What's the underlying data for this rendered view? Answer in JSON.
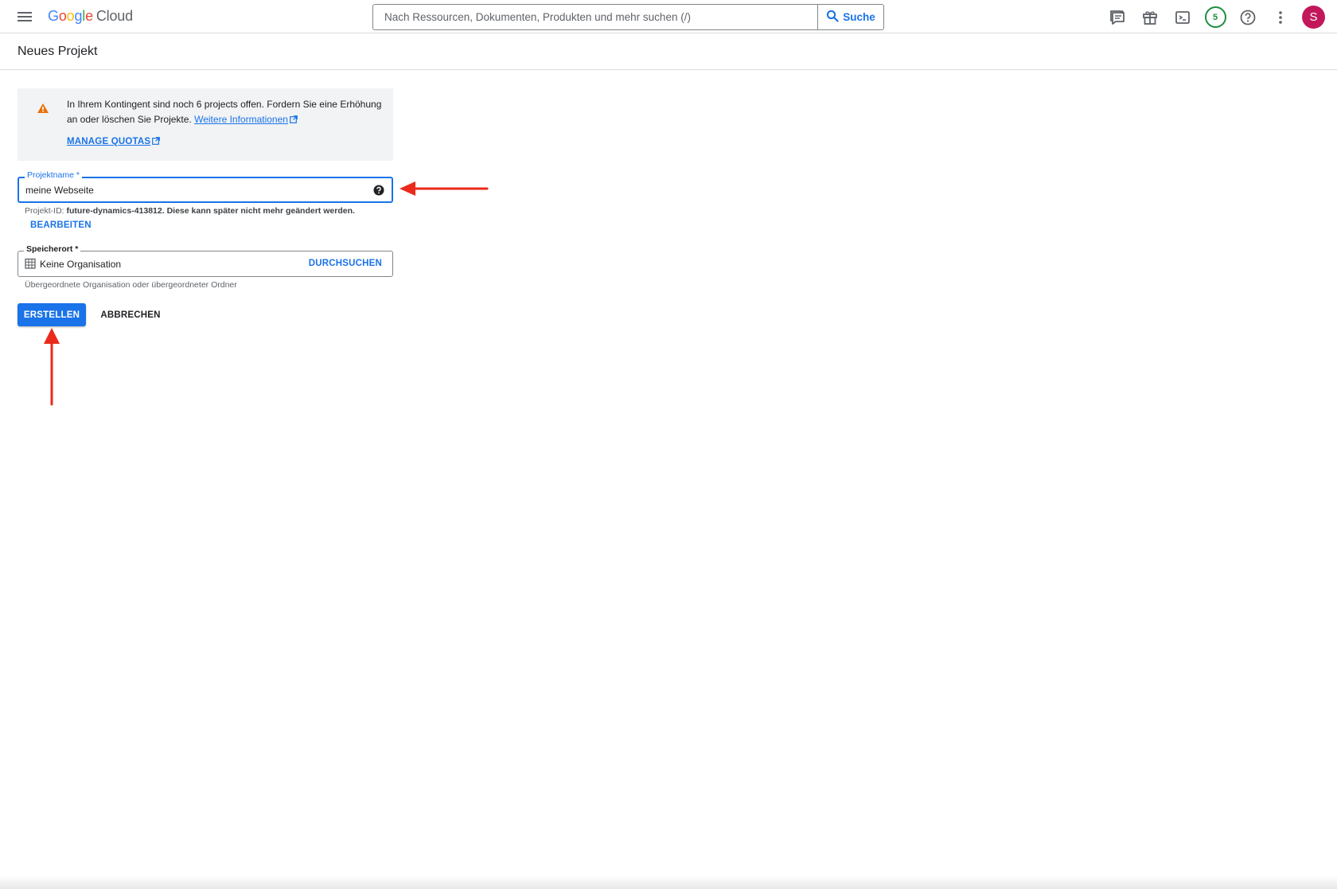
{
  "topbar": {
    "logo": {
      "google": [
        "G",
        "o",
        "o",
        "g",
        "l",
        "e"
      ],
      "cloud": "Cloud"
    },
    "search_placeholder": "Nach Ressourcen, Dokumenten, Produkten und mehr suchen (/)",
    "search_button": "Suche",
    "notification_count": "5",
    "avatar_letter": "S"
  },
  "page": {
    "title": "Neues Projekt"
  },
  "alert": {
    "text": "In Ihrem Kontingent sind noch 6 projects offen. Fordern Sie eine Erhöhung an oder löschen Sie Projekte.",
    "link": "Weitere Informationen",
    "manage_quotas": "MANAGE QUOTAS"
  },
  "project_name": {
    "label": "Projektname *",
    "value": "meine Webseite",
    "id_prefix": "Projekt-ID:",
    "id_value": "future-dynamics-413812.",
    "id_note": "Diese kann später nicht mehr geändert werden.",
    "edit": "BEARBEITEN"
  },
  "location": {
    "label": "Speicherort *",
    "value": "Keine Organisation",
    "browse": "DURCHSUCHEN",
    "hint": "Übergeordnete Organisation oder übergeordneter Ordner"
  },
  "actions": {
    "create": "ERSTELLEN",
    "cancel": "ABBRECHEN"
  },
  "colors": {
    "accent": "#1a73e8",
    "warning": "#e8710a",
    "annotation": "#ea2a1a",
    "avatar": "#c2185b",
    "badge": "#1e8e3e"
  }
}
